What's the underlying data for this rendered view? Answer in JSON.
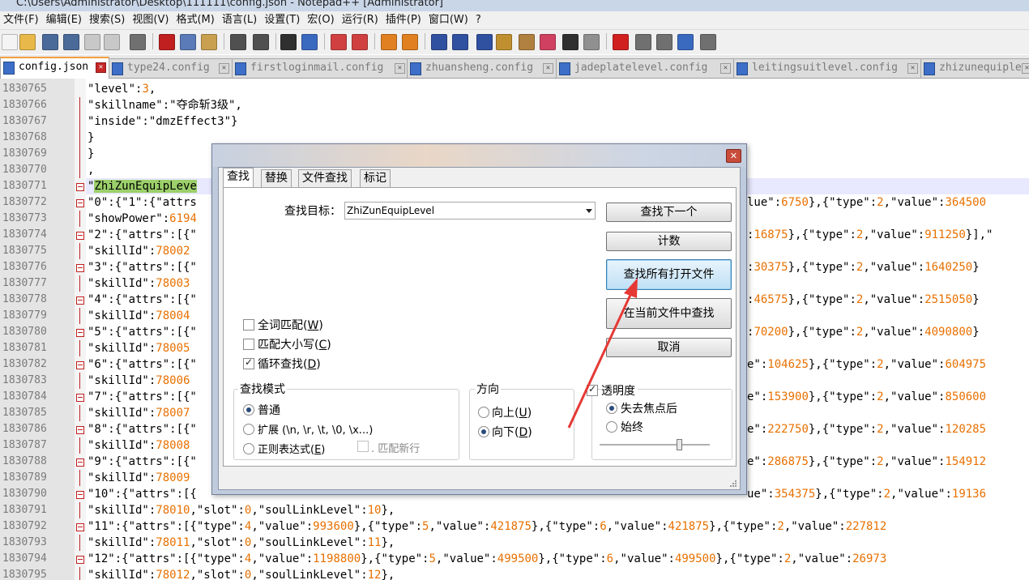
{
  "window": {
    "title": "C:\\Users\\Administrator\\Desktop\\111111\\config.json - Notepad++ [Administrator]"
  },
  "menu": [
    "文件(F)",
    "编辑(E)",
    "搜索(S)",
    "视图(V)",
    "格式(M)",
    "语言(L)",
    "设置(T)",
    "宏(O)",
    "运行(R)",
    "插件(P)",
    "窗口(W)",
    "?"
  ],
  "tabs": [
    {
      "label": "config.json",
      "active": true
    },
    {
      "label": "type24.config",
      "active": false
    },
    {
      "label": "firstloginmail.config",
      "active": false
    },
    {
      "label": "zhuansheng.config",
      "active": false
    },
    {
      "label": "jadeplatelevel.config",
      "active": false
    },
    {
      "label": "leitingsuitlevel.config",
      "active": false
    },
    {
      "label": "zhizunequiple",
      "active": false
    }
  ],
  "editor": {
    "lines": [
      {
        "num": "1830765",
        "text": "\"level\":3,"
      },
      {
        "num": "1830766",
        "text": "\"skillname\":\"夺命斩3级\","
      },
      {
        "num": "1830767",
        "text": "\"inside\":\"dmzEffect3\"}"
      },
      {
        "num": "1830768",
        "text": "}"
      },
      {
        "num": "1830769",
        "text": "}"
      },
      {
        "num": "1830770",
        "text": ","
      },
      {
        "num": "1830771",
        "text": "\"ZhiZunEquipLeve"
      },
      {
        "num": "1830772",
        "text": "\"0\":{\"1\":{\"attrs"
      },
      {
        "num": "1830773",
        "text": "\"showPower\":6194"
      },
      {
        "num": "1830774",
        "text": "\"2\":{\"attrs\":[{\""
      },
      {
        "num": "1830775",
        "text": "\"skillId\":78002"
      },
      {
        "num": "1830776",
        "text": "\"3\":{\"attrs\":[{\""
      },
      {
        "num": "1830777",
        "text": "\"skillId\":78003"
      },
      {
        "num": "1830778",
        "text": "\"4\":{\"attrs\":[{\""
      },
      {
        "num": "1830779",
        "text": "\"skillId\":78004"
      },
      {
        "num": "1830780",
        "text": "\"5\":{\"attrs\":[{\""
      },
      {
        "num": "1830781",
        "text": "\"skillId\":78005"
      },
      {
        "num": "1830782",
        "text": "\"6\":{\"attrs\":[{\""
      },
      {
        "num": "1830783",
        "text": "\"skillId\":78006"
      },
      {
        "num": "1830784",
        "text": "\"7\":{\"attrs\":[{\""
      },
      {
        "num": "1830785",
        "text": "\"skillId\":78007"
      },
      {
        "num": "1830786",
        "text": "\"8\":{\"attrs\":[{\""
      },
      {
        "num": "1830787",
        "text": "\"skillId\":78008"
      },
      {
        "num": "1830788",
        "text": "\"9\":{\"attrs\":[{\""
      },
      {
        "num": "1830789",
        "text": "\"skillId\":78009"
      },
      {
        "num": "1830790",
        "text": "\"10\":{\"attrs\":[{"
      },
      {
        "num": "1830791",
        "text": "\"skillId\":78010,\"slot\":0,\"soulLinkLevel\":10},"
      },
      {
        "num": "1830792",
        "text": "\"11\":{\"attrs\":[{\"type\":4,\"value\":993600},{\"type\":5,\"value\":421875},{\"type\":6,\"value\":421875},{\"type\":2,\"value\":227812"
      },
      {
        "num": "1830793",
        "text": "\"skillId\":78011,\"slot\":0,\"soulLinkLevel\":11},"
      },
      {
        "num": "1830794",
        "text": "\"12\":{\"attrs\":[{\"type\":4,\"value\":1198800},{\"type\":5,\"value\":499500},{\"type\":6,\"value\":499500},{\"type\":2,\"value\":26973"
      },
      {
        "num": "1830795",
        "text": "\"skillId\":78012,\"slot\":0,\"soulLinkLevel\":12},"
      }
    ],
    "right_fragments": [
      {
        "row": 7,
        "text": "lue\":6750},{\"type\":2,\"value\":364500"
      },
      {
        "row": 9,
        "text": ":16875},{\"type\":2,\"value\":911250}],\""
      },
      {
        "row": 11,
        "text": ":30375},{\"type\":2,\"value\":1640250}"
      },
      {
        "row": 13,
        "text": ":46575},{\"type\":2,\"value\":2515050}"
      },
      {
        "row": 15,
        "text": ":70200},{\"type\":2,\"value\":4090800}"
      },
      {
        "row": 17,
        "text": "e\":104625},{\"type\":2,\"value\":604975"
      },
      {
        "row": 19,
        "text": "e\":153900},{\"type\":2,\"value\":850600"
      },
      {
        "row": 21,
        "text": "e\":222750},{\"type\":2,\"value\":120285"
      },
      {
        "row": 23,
        "text": "e\":286875},{\"type\":2,\"value\":154912"
      },
      {
        "row": 25,
        "text": "ue\":354375},{\"type\":2,\"value\":19136"
      }
    ]
  },
  "dialog": {
    "tabs": [
      "查找",
      "替换",
      "文件查找",
      "标记"
    ],
    "find_label": "查找目标：",
    "find_value": "ZhiZunEquipLevel",
    "buttons": {
      "find_next": "查找下一个",
      "count": "计数",
      "find_all_open": "查找所有打开文件",
      "find_all_current": "在当前文件中查找",
      "cancel": "取消"
    },
    "options": {
      "whole_word": {
        "text": "全词匹配(",
        "key": "W",
        "end": ")",
        "checked": false
      },
      "match_case": {
        "text": "匹配大小写(",
        "key": "C",
        "end": ")",
        "checked": false
      },
      "wrap": {
        "text": "循环查找(",
        "key": "D",
        "end": ")",
        "checked": true
      }
    },
    "search_mode": {
      "title": "查找模式",
      "normal": "普通",
      "extended": "扩展 (\\n, \\r, \\t, \\0, \\x...)",
      "regex_text": "正则表达式(",
      "regex_key": "E",
      "regex_end": ")",
      "newline": ". 匹配新行",
      "selected": "normal"
    },
    "direction": {
      "title": "方向",
      "up_text": "向上(",
      "up_key": "U",
      "down_text": "向下(",
      "down_key": "D",
      "end": ")",
      "selected": "down"
    },
    "transparency": {
      "title": "透明度",
      "checked": true,
      "on_lose_focus": "失去焦点后",
      "always": "始终",
      "selected": "on_lose_focus",
      "level": 0.72
    }
  },
  "colors": {
    "annotation_arrow": "#e53935",
    "highlight": "#9bd06a",
    "accent_tab": "#f2a040"
  }
}
